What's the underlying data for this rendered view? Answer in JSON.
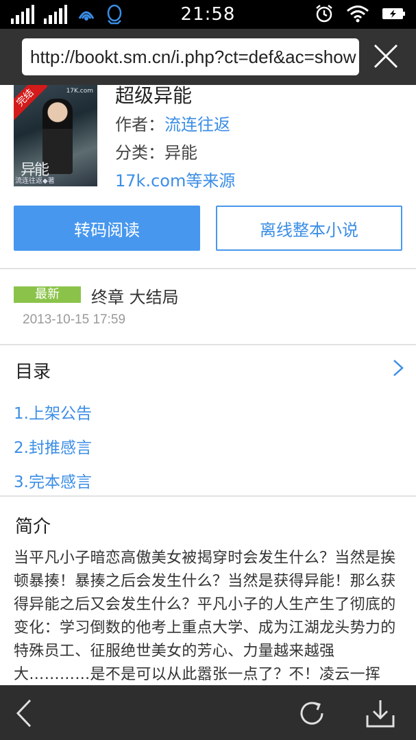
{
  "status_bar": {
    "time": "21:58",
    "left_icons": [
      "signal-1-icon",
      "signal-2-icon",
      "wifi-hotspot-icon",
      "qq-icon"
    ],
    "right_icons": [
      "alarm-icon",
      "wifi-icon",
      "battery-charging-icon"
    ]
  },
  "url_bar": {
    "url": "http://bookt.sm.cn/i.php?ct=def&ac=show"
  },
  "book": {
    "cover": {
      "badge": "完结",
      "site": "17K.com",
      "title": "异能",
      "author": "流连往返◆著"
    },
    "title": "超级异能",
    "author_label": "作者：",
    "author": "流连往返",
    "category_label": "分类：",
    "category": "异能",
    "source": "17k.com等来源"
  },
  "actions": {
    "read_label": "转码阅读",
    "offline_label": "离线整本小说"
  },
  "latest": {
    "badge": "最新",
    "chapter": "终章 大结局",
    "time": "2013-10-15 17:59"
  },
  "toc": {
    "title": "目录",
    "items": [
      {
        "label": "1.上架公告"
      },
      {
        "label": "2.封推感言"
      },
      {
        "label": "3.完本感言"
      }
    ]
  },
  "intro": {
    "title": "简介",
    "text": "当平凡小子暗恋高傲美女被揭穿时会发生什么？当然是挨顿暴揍！暴揍之后会发生什么？当然是获得异能！那么获得异能之后又会发生什么？平凡小子的人生产生了彻底的变化：学习倒数的他考上重点大学、成为江湖龙头势力的特殊员工、征服绝世美女的芳心、力量越来越强大…………是不是可以从此嚣张一点了？不！凌云一挥手，浩浩荡荡一幅幅，风生水起，一桩桩大事件"
  },
  "toolbar": {
    "icons": [
      "back-icon",
      "refresh-icon",
      "download-icon"
    ]
  }
}
